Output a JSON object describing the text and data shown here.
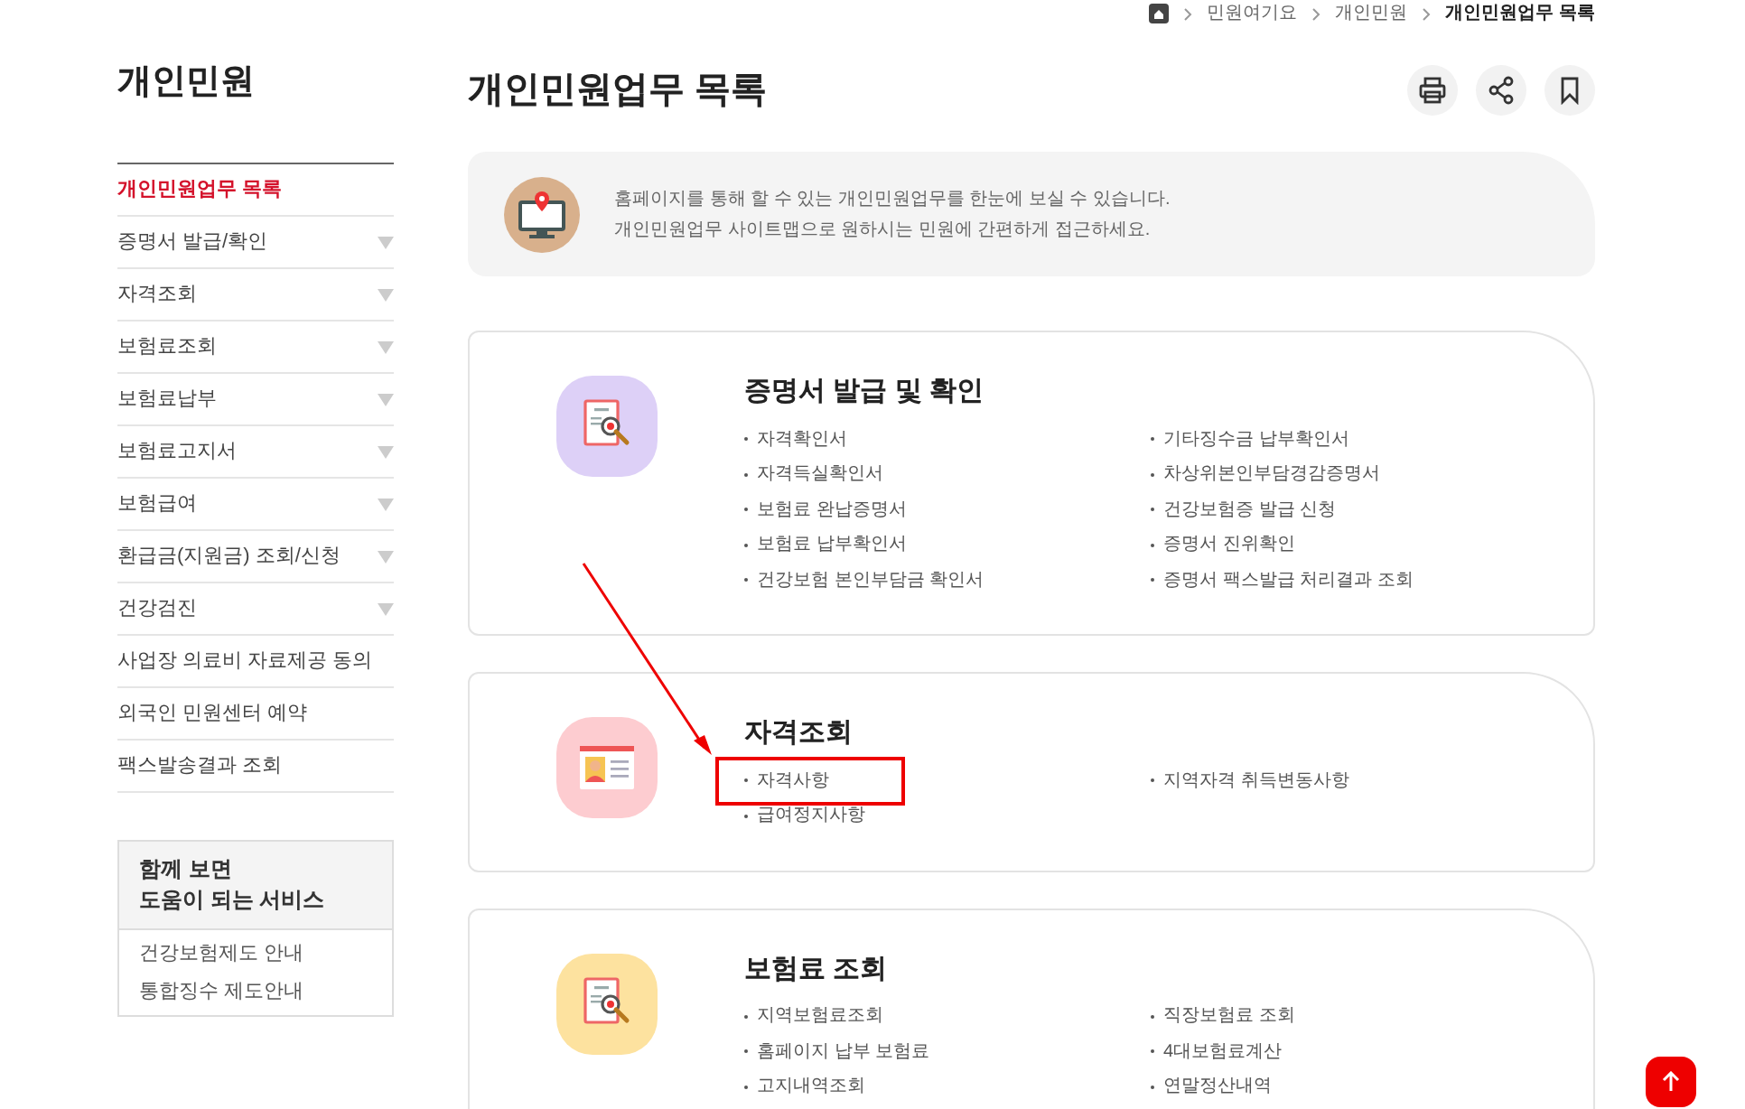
{
  "breadcrumb": [
    "민원여기요",
    "개인민원",
    "개인민원업무 목록"
  ],
  "sidebar": {
    "title": "개인민원",
    "items": [
      {
        "label": "개인민원업무 목록",
        "selected": true,
        "expandable": false
      },
      {
        "label": "증명서 발급/확인",
        "selected": false,
        "expandable": true
      },
      {
        "label": "자격조회",
        "selected": false,
        "expandable": true
      },
      {
        "label": "보험료조회",
        "selected": false,
        "expandable": true
      },
      {
        "label": "보험료납부",
        "selected": false,
        "expandable": true
      },
      {
        "label": "보험료고지서",
        "selected": false,
        "expandable": true
      },
      {
        "label": "보험급여",
        "selected": false,
        "expandable": true
      },
      {
        "label": "환급금(지원금) 조회/신청",
        "selected": false,
        "expandable": true
      },
      {
        "label": "건강검진",
        "selected": false,
        "expandable": true
      },
      {
        "label": "사업장 의료비 자료제공 동의",
        "selected": false,
        "expandable": false
      },
      {
        "label": "외국인 민원센터 예약",
        "selected": false,
        "expandable": false
      },
      {
        "label": "팩스발송결과 조회",
        "selected": false,
        "expandable": false
      }
    ],
    "related": {
      "title": [
        "함께 보면",
        "도움이 되는 서비스"
      ],
      "links": [
        "건강보험제도 안내",
        "통합징수 제도안내"
      ]
    }
  },
  "page_title": "개인민원업무 목록",
  "intro": [
    "홈페이지를 통해 할 수 있는 개인민원업무를 한눈에 보실 수 있습니다.",
    "개인민원업무 사이트맵으로 원하시는 민원에 간편하게 접근하세요."
  ],
  "sections": [
    {
      "title": "증명서 발급 및 확인",
      "kind": "document",
      "color": "#ddd0f7",
      "items": [
        {
          "label": "자격확인서",
          "highlighted": false
        },
        {
          "label": "기타징수금 납부확인서",
          "highlighted": false
        },
        {
          "label": "자격득실확인서",
          "highlighted": false
        },
        {
          "label": "차상위본인부담경감증명서",
          "highlighted": false
        },
        {
          "label": "보험료 완납증명서",
          "highlighted": false
        },
        {
          "label": "건강보험증 발급 신청",
          "highlighted": false
        },
        {
          "label": "보험료 납부확인서",
          "highlighted": false
        },
        {
          "label": "증명서 진위확인",
          "highlighted": false
        },
        {
          "label": "건강보험 본인부담금 확인서",
          "highlighted": false
        },
        {
          "label": "증명서 팩스발급 처리결과 조회",
          "highlighted": false
        }
      ]
    },
    {
      "title": "자격조회",
      "kind": "id-card",
      "color": "#fdccd0",
      "items": [
        {
          "label": "자격사항",
          "highlighted": true
        },
        {
          "label": "지역자격 취득변동사항",
          "highlighted": false
        },
        {
          "label": "급여정지사항",
          "highlighted": false
        }
      ]
    },
    {
      "title": "보험료 조회",
      "kind": "document",
      "color": "#fde29f",
      "items": [
        {
          "label": "지역보험료조회",
          "highlighted": false
        },
        {
          "label": "직장보험료 조회",
          "highlighted": false
        },
        {
          "label": "홈페이지 납부 보험료",
          "highlighted": false
        },
        {
          "label": "4대보험료계산",
          "highlighted": false
        },
        {
          "label": "고지내역조회",
          "highlighted": false
        },
        {
          "label": "연말정산내역",
          "highlighted": false
        }
      ]
    }
  ]
}
